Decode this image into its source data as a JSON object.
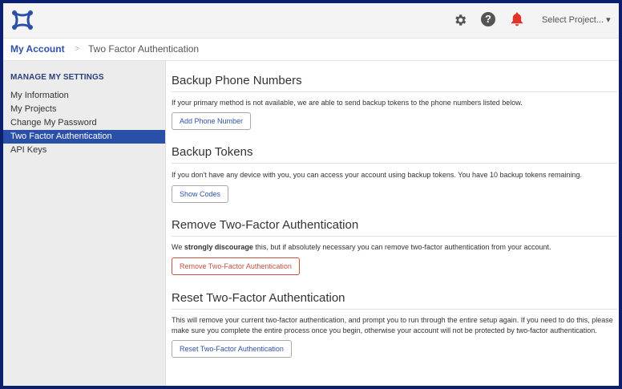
{
  "topbar": {
    "project_select_label": "Select Project...",
    "caret": "▾"
  },
  "breadcrumb": {
    "home": "My Account",
    "separator": ">",
    "current": "Two Factor Authentication"
  },
  "sidebar": {
    "heading": "MANAGE MY SETTINGS",
    "items": [
      {
        "label": "My Information"
      },
      {
        "label": "My Projects"
      },
      {
        "label": "Change My Password"
      },
      {
        "label": "Two Factor Authentication"
      },
      {
        "label": "API Keys"
      }
    ]
  },
  "sections": {
    "backup_phones": {
      "title": "Backup Phone Numbers",
      "description": "If your primary method is not available, we are able to send backup tokens to the phone numbers listed below.",
      "button": "Add Phone Number"
    },
    "backup_tokens": {
      "title": "Backup Tokens",
      "description": "If you don't have any device with you, you can access your account using backup tokens. You have 10 backup tokens remaining.",
      "button": "Show Codes"
    },
    "remove_2fa": {
      "title": "Remove Two-Factor Authentication",
      "desc_prefix": "We ",
      "desc_strong": "strongly discourage",
      "desc_suffix": " this, but if absolutely necessary you can remove two-factor authentication from your account.",
      "button": "Remove Two-Factor Authentication"
    },
    "reset_2fa": {
      "title": "Reset Two-Factor Authentication",
      "description": "This will remove your current two-factor authentication, and prompt you to run through the entire setup again. If you need to do this, please make sure you complete the entire process once you begin, otherwise your account will not be protected by two-factor authentication.",
      "button": "Reset Two-Factor Authentication"
    }
  },
  "colors": {
    "accent": "#2a4fa8",
    "danger": "#c9503f",
    "bell": "#e0332b",
    "frame": "#0a1f6e"
  },
  "icons": [
    "logo-icon",
    "gear-icon",
    "help-icon",
    "bell-icon",
    "caret-down-icon"
  ]
}
